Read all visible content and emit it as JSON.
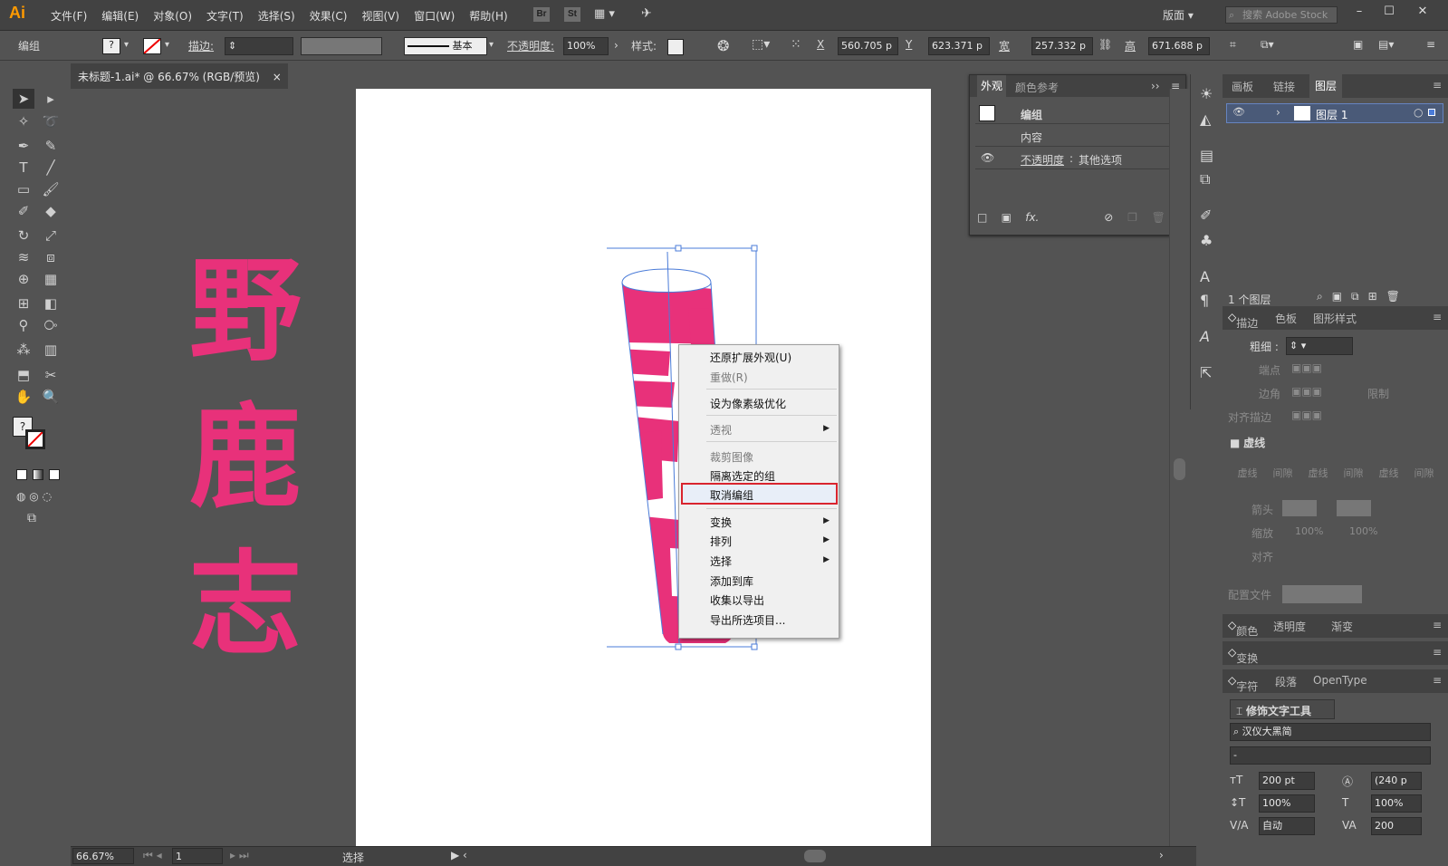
{
  "app": {
    "logo": "Ai",
    "menus": [
      "文件(F)",
      "编辑(E)",
      "对象(O)",
      "文字(T)",
      "选择(S)",
      "效果(C)",
      "视图(V)",
      "窗口(W)",
      "帮助(H)"
    ],
    "bridge": "Br",
    "stock": "St",
    "workspace": "版面",
    "search_placeholder": "搜索 Adobe Stock"
  },
  "control": {
    "selection": "编组",
    "stroke_label": "描边",
    "stroke_style": "基本",
    "opacity_label": "不透明度",
    "opacity_value": "100%",
    "style_label": "样式",
    "x_label": "X",
    "x_value": "560.705 p",
    "y_label": "Y",
    "y_value": "623.371 p",
    "w_label": "宽",
    "w_value": "257.332 p",
    "h_label": "高",
    "h_value": "671.688 p"
  },
  "document": {
    "tab_title": "未标题-1.ai* @ 66.67% (RGB/预览)",
    "close": "×"
  },
  "artwork": {
    "chars": [
      "野",
      "鹿",
      "志"
    ],
    "color": "#e8317a"
  },
  "appearance": {
    "tabs": [
      "外观",
      "颜色参考"
    ],
    "rows": [
      "编组",
      "内容",
      "不透明度",
      "其他选项"
    ],
    "fx": "fx."
  },
  "layers": {
    "tabs": [
      "画板",
      "链接",
      "图层"
    ],
    "layer_name": "图层 1",
    "count": "1 个图层"
  },
  "stroke_panel": {
    "tabs": [
      "描边",
      "色板",
      "图形样式"
    ],
    "weight_label": "粗细",
    "cap_label": "端点",
    "corner_label": "边角",
    "limit_label": "限制",
    "align_label": "对齐描边",
    "dashed_label": "虚线",
    "dash_cells": [
      "虚线",
      "间隙",
      "虚线",
      "间隙",
      "虚线",
      "间隙"
    ],
    "arrow_label": "箭头",
    "scale_label": "缩放",
    "scale1": "100%",
    "scale2": "100%",
    "align2_label": "对齐",
    "profile_label": "配置文件"
  },
  "color_panel": {
    "tabs": [
      "颜色",
      "透明度",
      "渐变"
    ]
  },
  "transform_panel": {
    "tab": "变换"
  },
  "char_panel": {
    "tabs": [
      "字符",
      "段落",
      "OpenType"
    ],
    "touch_tool": "修饰文字工具",
    "font": "汉仪大黑简",
    "style": "-",
    "size": "200 pt",
    "leading": "(240 p",
    "vscale": "100%",
    "hscale": "100%",
    "kerning": "自动",
    "tracking": "200"
  },
  "context_menu": {
    "items": [
      {
        "label": "还原扩展外观(U)",
        "disabled": false
      },
      {
        "label": "重做(R)",
        "disabled": true
      },
      {
        "label": "设为像素级优化",
        "disabled": false
      },
      {
        "label": "透视",
        "disabled": true,
        "sub": true
      },
      {
        "label": "裁剪图像",
        "disabled": true
      },
      {
        "label": "隔离选定的组",
        "disabled": false
      },
      {
        "label": "取消编组",
        "disabled": false,
        "highlight": true
      },
      {
        "label": "变换",
        "disabled": false,
        "sub": true
      },
      {
        "label": "排列",
        "disabled": false,
        "sub": true
      },
      {
        "label": "选择",
        "disabled": false,
        "sub": true
      },
      {
        "label": "添加到库",
        "disabled": false
      },
      {
        "label": "收集以导出",
        "disabled": false
      },
      {
        "label": "导出所选项目...",
        "disabled": false
      }
    ]
  },
  "status": {
    "zoom": "66.67%",
    "page": "1",
    "tool": "选择"
  }
}
